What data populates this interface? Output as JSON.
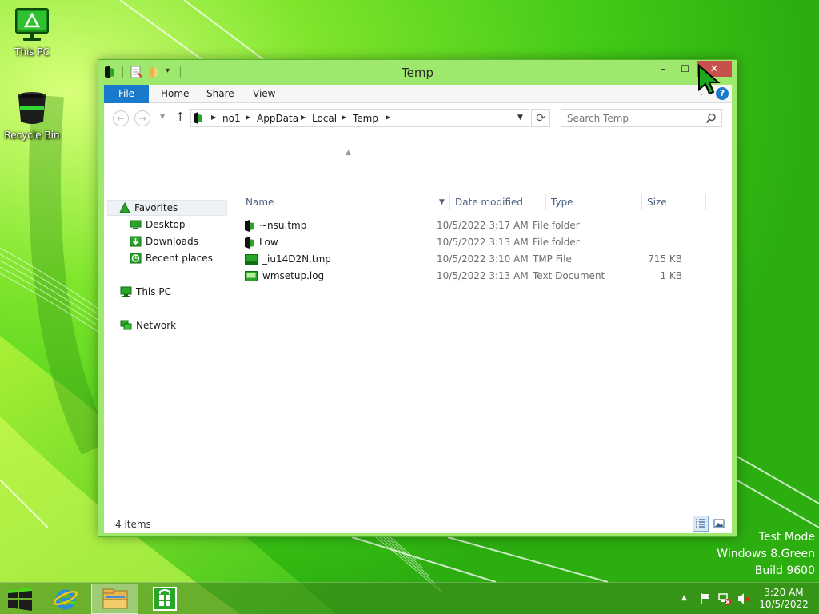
{
  "desktop": {
    "icons": [
      {
        "label": "This PC"
      },
      {
        "label": "Recycle Bin"
      }
    ],
    "watermark": {
      "line1": "Test Mode",
      "line2": "Windows 8.Green",
      "line3": "Build 9600"
    },
    "accent_color": "#4fd61b"
  },
  "window": {
    "title": "Temp",
    "controls": {
      "minimize": "–",
      "maximize": "☐",
      "close": "✕"
    },
    "ribbon": {
      "tabs": [
        {
          "label": "File"
        },
        {
          "label": "Home"
        },
        {
          "label": "Share"
        },
        {
          "label": "View"
        }
      ],
      "help": "?"
    },
    "address": {
      "breadcrumbs": [
        "no1",
        "AppData",
        "Local",
        "Temp"
      ]
    },
    "search": {
      "placeholder": "Search Temp"
    },
    "navigation": {
      "favorites": "Favorites",
      "favorites_items": [
        "Desktop",
        "Downloads",
        "Recent places"
      ],
      "this_pc": "This PC",
      "network": "Network"
    },
    "columns": {
      "name": "Name",
      "date": "Date modified",
      "type": "Type",
      "size": "Size"
    },
    "files": [
      {
        "name": "~nsu.tmp",
        "date": "10/5/2022 3:17 AM",
        "type": "File folder",
        "size": "",
        "icon": "folder-icon"
      },
      {
        "name": "Low",
        "date": "10/5/2022 3:13 AM",
        "type": "File folder",
        "size": "",
        "icon": "folder-icon"
      },
      {
        "name": "_iu14D2N.tmp",
        "date": "10/5/2022 3:10 AM",
        "type": "TMP File",
        "size": "715 KB",
        "icon": "file-icon"
      },
      {
        "name": "wmsetup.log",
        "date": "10/5/2022 3:13 AM",
        "type": "Text Document",
        "size": "1 KB",
        "icon": "text-document-icon"
      }
    ],
    "status": {
      "item_count": "4 items"
    }
  },
  "taskbar": {
    "clock": {
      "time": "3:20 AM",
      "date": "10/5/2022"
    },
    "tray_expand": "▲"
  }
}
